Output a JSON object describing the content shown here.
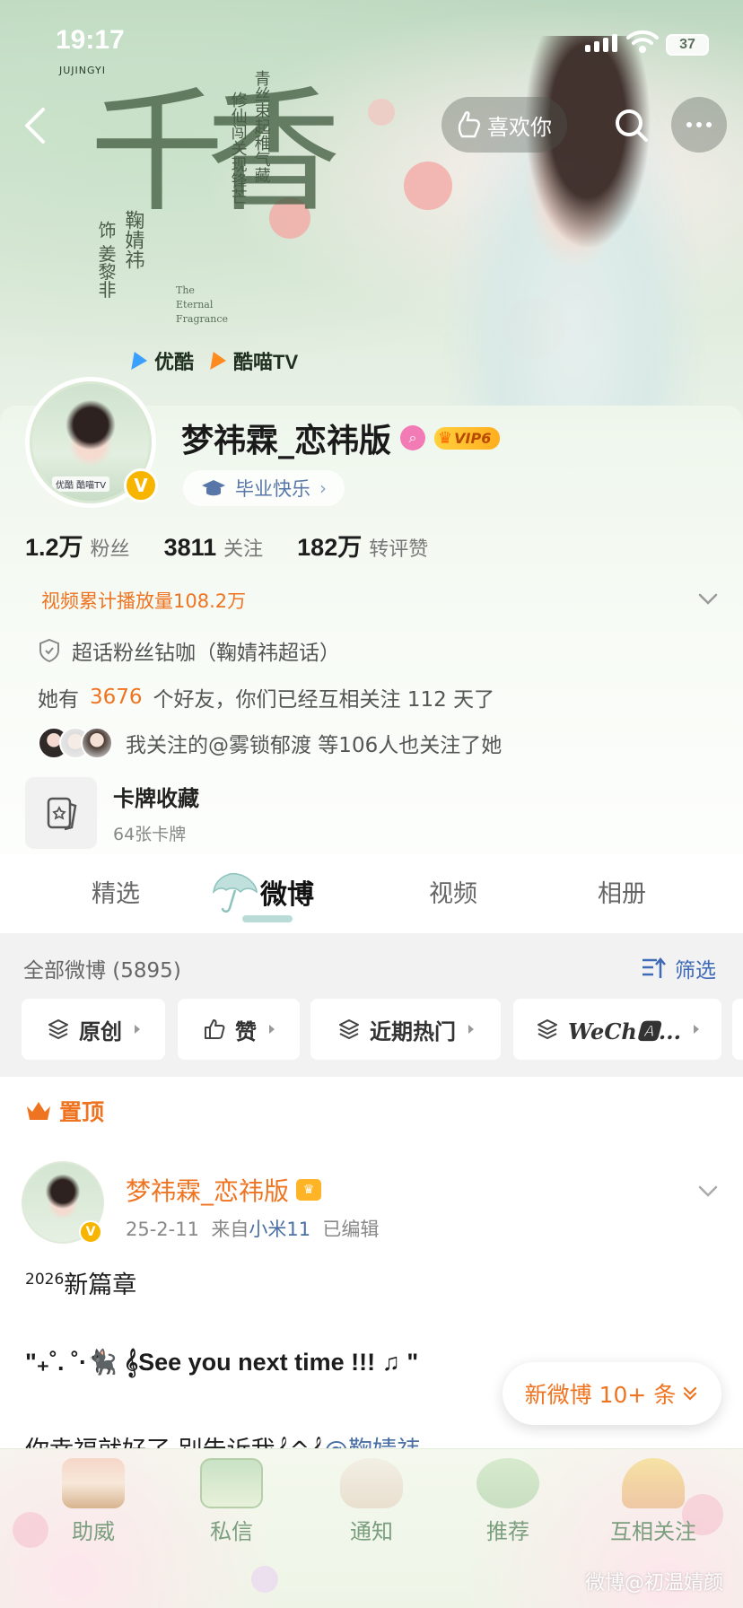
{
  "status_bar": {
    "time": "19:17",
    "subtitle": "JUJINGYI",
    "battery": "37"
  },
  "banner": {
    "title_calligraphy": "千香",
    "vertical_text_1": "青丝束起稚气藏",
    "vertical_text_2": "修仙闯关现锋芒",
    "vertical_text_3": "鞠婧祎",
    "vertical_text_4": "饰 姜黎非",
    "english": [
      "The",
      "Eternal",
      "Fragrance"
    ],
    "platform_1": "优酷",
    "platform_2": "酷喵TV"
  },
  "header": {
    "like_label": "喜欢你"
  },
  "profile": {
    "avatar_tag": "优酷 酷喵TV",
    "verified_badge": "V",
    "name": "梦祎霖_恋祎版",
    "vip_label": "VIP6",
    "graduation_tag": "毕业快乐",
    "stats": [
      {
        "num": "1.2万",
        "label": "粉丝"
      },
      {
        "num": "3811",
        "label": "关注"
      },
      {
        "num": "182万",
        "label": "转评赞"
      }
    ],
    "video_views": "视频累计播放量108.2万",
    "super_topic": "超话粉丝钻咖（鞠婧祎超话）",
    "friends_prefix": "她有",
    "friends_count": "3676",
    "friends_suffix": "个好友，你们已经互相关注 112 天了",
    "mutual_follow": "我关注的@雾锁郁渡  等106人也关注了她",
    "card_title": "卡牌收藏",
    "card_sub": "64张卡牌"
  },
  "tabs": [
    "精选",
    "微博",
    "视频",
    "相册"
  ],
  "active_tab": "微博",
  "filter": {
    "count_label": "全部微博 (5895)",
    "sift_label": "筛选",
    "chips": [
      "原创",
      "赞",
      "近期热门",
      "WeCh🅰..."
    ]
  },
  "pinned_label": "置顶",
  "post": {
    "author": "梦祎霖_恋祎版",
    "date": "25-2-11",
    "source_prefix": "来自",
    "device": "小米11",
    "edited": "已编辑",
    "line1_sup": "2026",
    "line1": "新篇章",
    "line2": "\"₊˚. ˚·🐈‍⬛ 𝄞See you next time !!! ♫ \"",
    "line3_prefix": "你幸福就好了 别告诉我𝄞^𝄞",
    "line3_mention": "@鞠婧祎"
  },
  "new_posts_pill": "新微博 10+ 条",
  "bottom_bar": [
    "助威",
    "私信",
    "通知",
    "推荐",
    "互相关注"
  ],
  "watermark": "微博@初温婧颜",
  "colors": {
    "accent_orange": "#ee7421",
    "link_blue": "#4a6fa5",
    "vip_gold": "#ffb426"
  }
}
